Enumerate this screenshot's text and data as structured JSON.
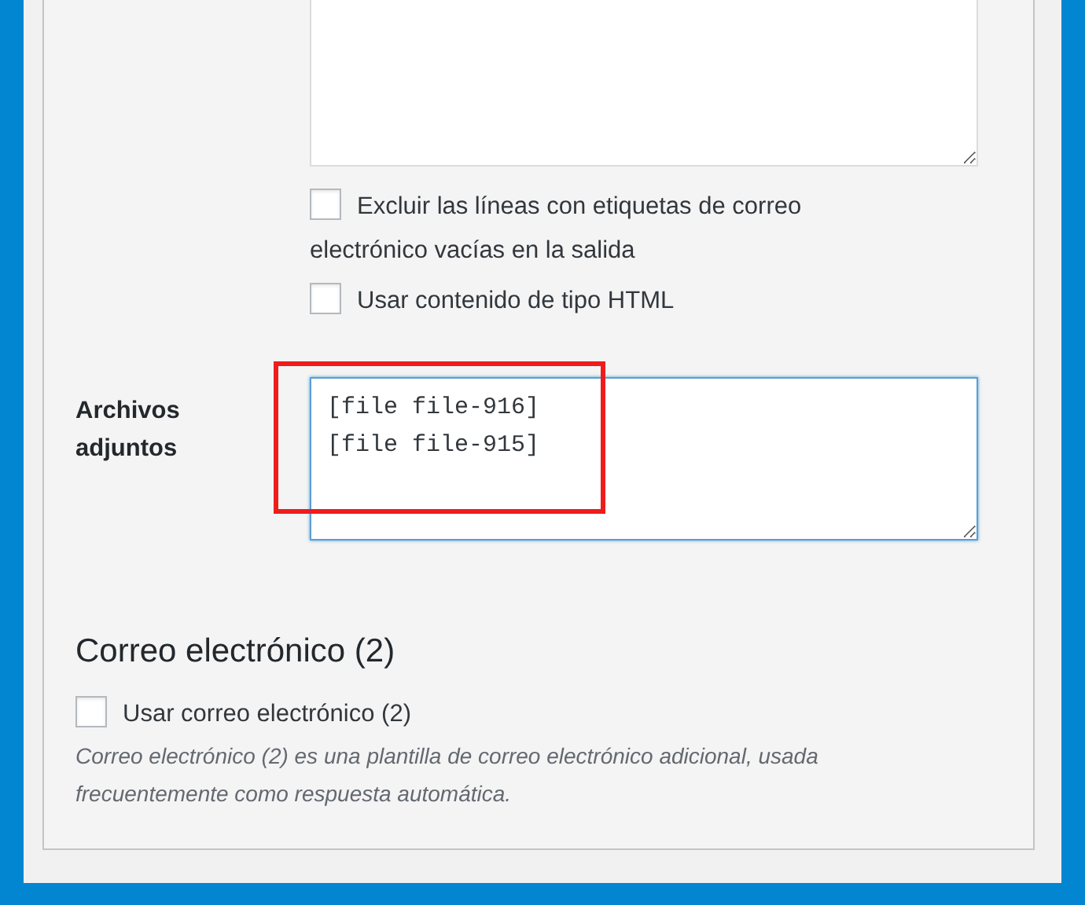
{
  "message_options": [
    {
      "label": "Excluir las líneas con etiquetas de correo electrónico vacías en la salida",
      "checked": false
    },
    {
      "label": "Usar contenido de tipo HTML",
      "checked": false
    }
  ],
  "attachments": {
    "label": "Archivos adjuntos",
    "value": "[file file-916]\n[file file-915]",
    "focused": true,
    "highlighted": true
  },
  "mail_2": {
    "title": "Correo electrónico (2)",
    "option": {
      "label": "Usar correo electrónico (2)",
      "checked": false
    },
    "description": "Correo electrónico (2) es una plantilla de correo electrónico adicional, usada frecuentemente como respuesta automática."
  }
}
